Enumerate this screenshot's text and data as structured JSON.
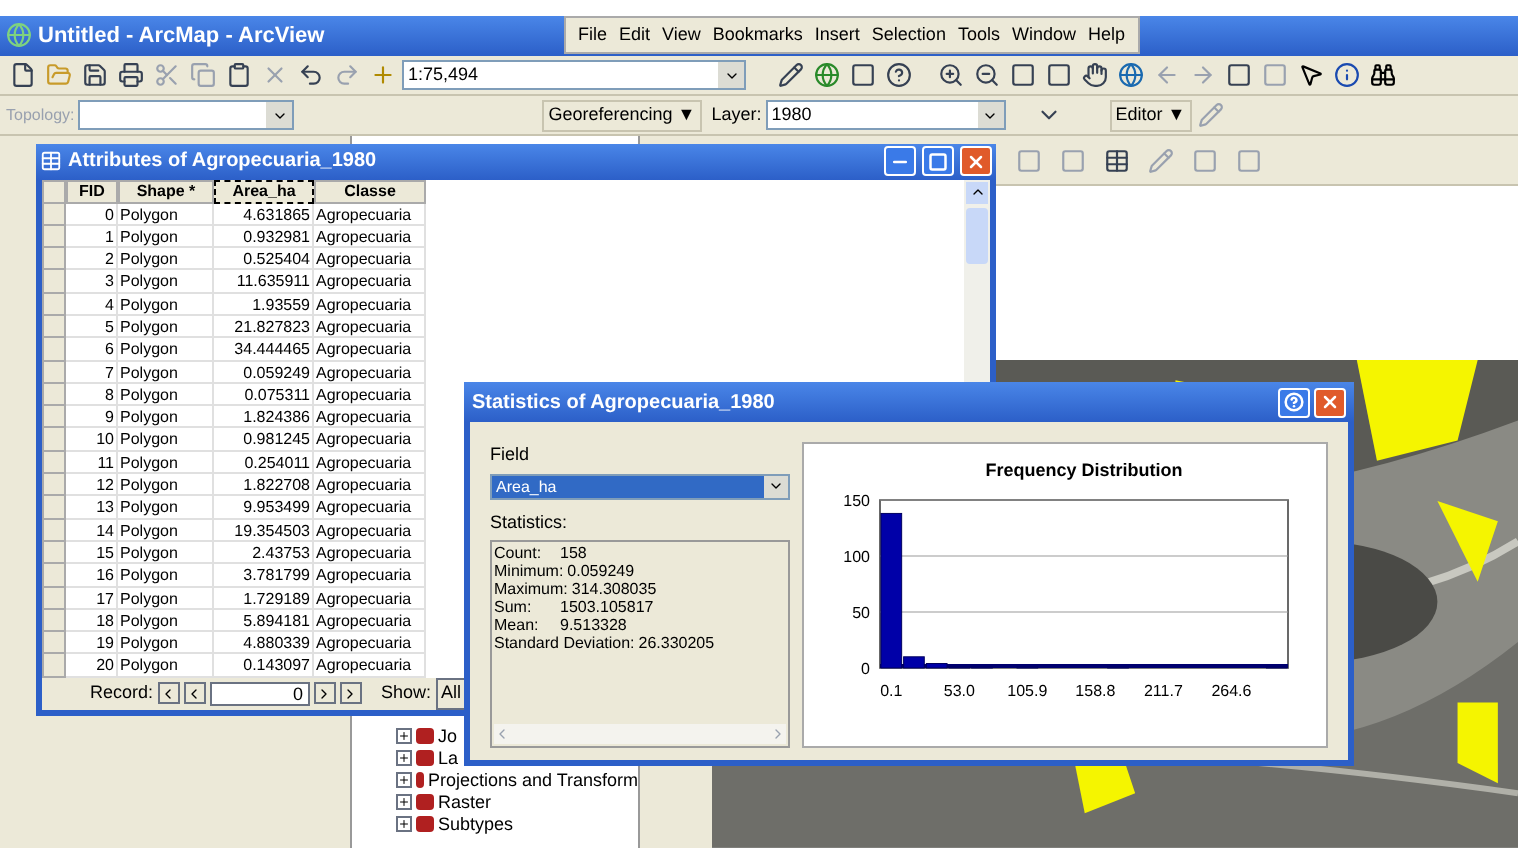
{
  "window": {
    "title": "Untitled - ArcMap - ArcView"
  },
  "menu": [
    "File",
    "Edit",
    "View",
    "Bookmarks",
    "Insert",
    "Selection",
    "Tools",
    "Window",
    "Help"
  ],
  "toolbar": {
    "scale": "1:75,494",
    "topology_label": "Topology:",
    "georeferencing": "Georeferencing ▼",
    "layer_label": "Layer:",
    "layer": "1980",
    "editor": "Editor ▼"
  },
  "toc": {
    "items": [
      {
        "label": "Jo",
        "expanded": false
      },
      {
        "label": "La",
        "expanded": false
      },
      {
        "label": "Projections and Transform",
        "expanded": false
      },
      {
        "label": "Raster",
        "expanded": false
      },
      {
        "label": "Subtypes",
        "expanded": false
      }
    ]
  },
  "attributes": {
    "title": "Attributes of Agropecuaria_1980",
    "columns": [
      {
        "label": "FID",
        "selected": false
      },
      {
        "label": "Shape *",
        "selected": false
      },
      {
        "label": "Area_ha",
        "selected": true
      },
      {
        "label": "Classe",
        "selected": false
      }
    ],
    "rows": [
      [
        "0",
        "Polygon",
        "4.631865",
        "Agropecuaria"
      ],
      [
        "1",
        "Polygon",
        "0.932981",
        "Agropecuaria"
      ],
      [
        "2",
        "Polygon",
        "0.525404",
        "Agropecuaria"
      ],
      [
        "3",
        "Polygon",
        "11.635911",
        "Agropecuaria"
      ],
      [
        "4",
        "Polygon",
        "1.93559",
        "Agropecuaria"
      ],
      [
        "5",
        "Polygon",
        "21.827823",
        "Agropecuaria"
      ],
      [
        "6",
        "Polygon",
        "34.444465",
        "Agropecuaria"
      ],
      [
        "7",
        "Polygon",
        "0.059249",
        "Agropecuaria"
      ],
      [
        "8",
        "Polygon",
        "0.075311",
        "Agropecuaria"
      ],
      [
        "9",
        "Polygon",
        "1.824386",
        "Agropecuaria"
      ],
      [
        "10",
        "Polygon",
        "0.981245",
        "Agropecuaria"
      ],
      [
        "11",
        "Polygon",
        "0.254011",
        "Agropecuaria"
      ],
      [
        "12",
        "Polygon",
        "1.822708",
        "Agropecuaria"
      ],
      [
        "13",
        "Polygon",
        "9.953499",
        "Agropecuaria"
      ],
      [
        "14",
        "Polygon",
        "19.354503",
        "Agropecuaria"
      ],
      [
        "15",
        "Polygon",
        "2.43753",
        "Agropecuaria"
      ],
      [
        "16",
        "Polygon",
        "3.781799",
        "Agropecuaria"
      ],
      [
        "17",
        "Polygon",
        "1.729189",
        "Agropecuaria"
      ],
      [
        "18",
        "Polygon",
        "5.894181",
        "Agropecuaria"
      ],
      [
        "19",
        "Polygon",
        "4.880339",
        "Agropecuaria"
      ],
      [
        "20",
        "Polygon",
        "0.143097",
        "Agropecuaria"
      ]
    ],
    "record_label": "Record:",
    "record": "0",
    "show_label": "Show:",
    "show": "All"
  },
  "statistics": {
    "title": "Statistics of Agropecuaria_1980",
    "field_label": "Field",
    "field": "Area_ha",
    "stats_label": "Statistics:",
    "stats": [
      {
        "label": "Count:",
        "value": "158"
      },
      {
        "label": "Minimum:",
        "value": "0.059249"
      },
      {
        "label": "Maximum:",
        "value": "314.308035"
      },
      {
        "label": "Sum:",
        "value": "1503.105817"
      },
      {
        "label": "Mean:",
        "value": "9.513328"
      },
      {
        "label": "Standard Deviation:",
        "value": "26.330205"
      }
    ],
    "chart_data": {
      "type": "bar",
      "title": "Frequency Distribution",
      "x": [
        0.1,
        17.7,
        35.4,
        53.0,
        70.6,
        88.3,
        105.9,
        123.5,
        141.2,
        158.8,
        176.4,
        194.1,
        211.7,
        229.3,
        247.0,
        264.6,
        282.2,
        299.9
      ],
      "values": [
        138,
        10,
        4,
        1,
        1,
        0,
        1,
        0,
        0,
        0,
        1,
        0,
        0,
        0,
        0,
        0,
        0,
        1
      ],
      "xlim": [
        -8.7,
        308.6
      ],
      "ylim": [
        0,
        150
      ],
      "yticks": [
        0,
        50,
        100,
        150
      ],
      "xticks": [
        {
          "value": 0.1,
          "label": "0.1"
        },
        {
          "value": 53.0,
          "label": "53.0"
        },
        {
          "value": 105.9,
          "label": "105.9"
        },
        {
          "value": 158.8,
          "label": "158.8"
        },
        {
          "value": 211.7,
          "label": "211.7"
        },
        {
          "value": 264.6,
          "label": "264.6"
        }
      ]
    }
  }
}
